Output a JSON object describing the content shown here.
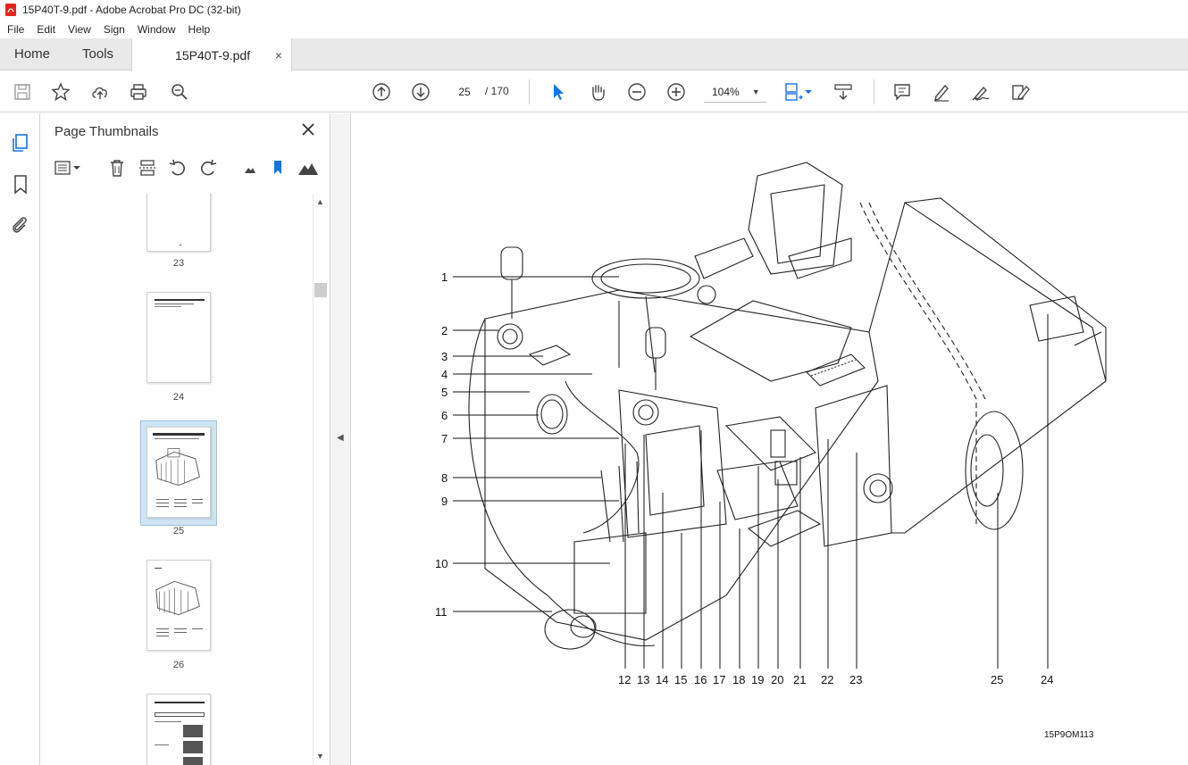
{
  "window": {
    "title": "15P40T-9.pdf - Adobe Acrobat Pro DC (32-bit)"
  },
  "menu": [
    "File",
    "Edit",
    "View",
    "Sign",
    "Window",
    "Help"
  ],
  "tabs": {
    "home": "Home",
    "tools": "Tools",
    "document": "15P40T-9.pdf",
    "close": "×"
  },
  "toolbar": {
    "page_current": "25",
    "page_total": "/ 170",
    "zoom": "104%"
  },
  "pane": {
    "title": "Page Thumbnails"
  },
  "thumbnails": [
    {
      "label": "23"
    },
    {
      "label": "24"
    },
    {
      "label": "25",
      "selected": true
    },
    {
      "label": "26"
    }
  ],
  "figure": {
    "callouts_left": [
      "1",
      "2",
      "3",
      "4",
      "5",
      "6",
      "7",
      "8",
      "9",
      "10",
      "11"
    ],
    "callouts_bottom": [
      "12",
      "13",
      "14",
      "15",
      "16",
      "17",
      "18",
      "19",
      "20",
      "21",
      "22",
      "23",
      "25",
      "24"
    ],
    "code": "15P9OM113"
  },
  "colors": {
    "accent": "#1473e6",
    "selection": "#cfe4f3"
  }
}
